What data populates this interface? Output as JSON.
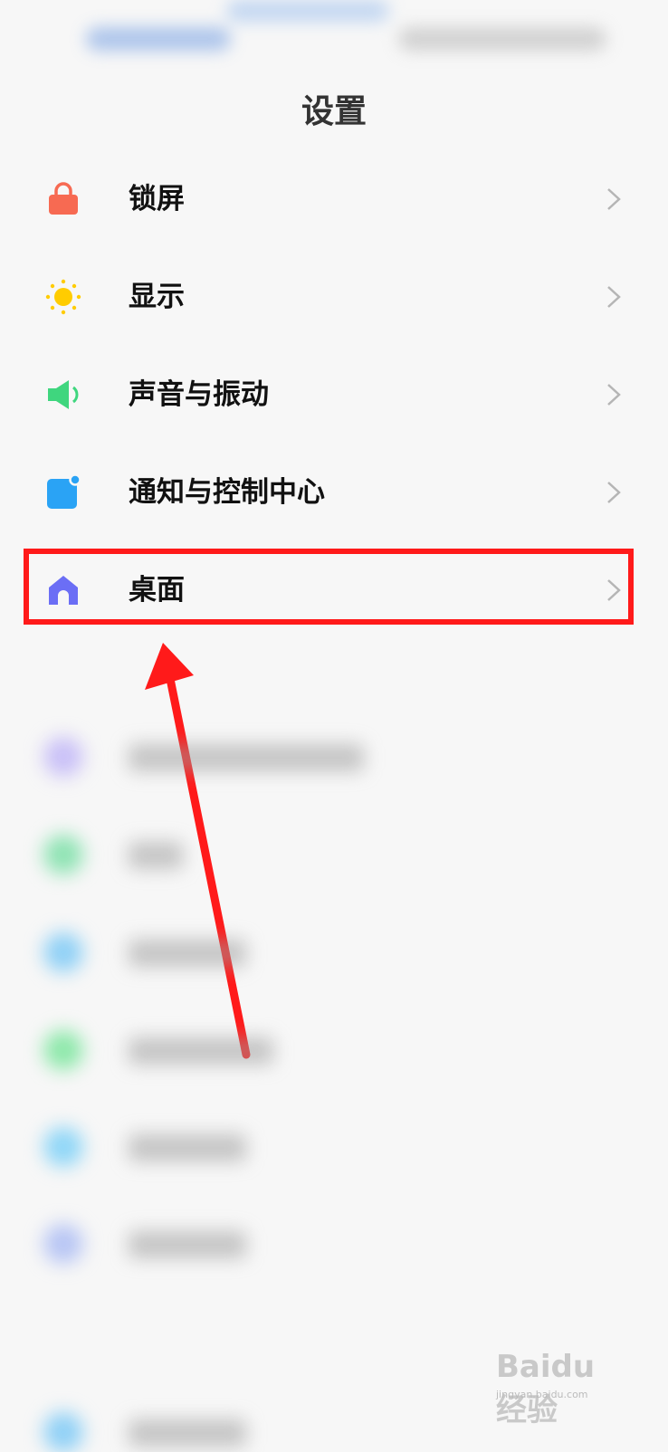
{
  "header": {
    "title": "设置"
  },
  "settings": {
    "items": [
      {
        "label": "锁屏",
        "icon": "lock-icon",
        "color": "#f76a52"
      },
      {
        "label": "显示",
        "icon": "sun-icon",
        "color": "#ffcc00"
      },
      {
        "label": "声音与振动",
        "icon": "speaker-icon",
        "color": "#3fd67e"
      },
      {
        "label": "通知与控制中心",
        "icon": "notification-icon",
        "color": "#2aa3f5"
      },
      {
        "label": "桌面",
        "icon": "home-icon",
        "color": "#6b6ef5"
      }
    ]
  },
  "annotation": {
    "highlight_color": "#ff1a1a"
  },
  "watermark": {
    "logo_text": "Baidu经验",
    "url": "jingyan.baidu.com"
  }
}
